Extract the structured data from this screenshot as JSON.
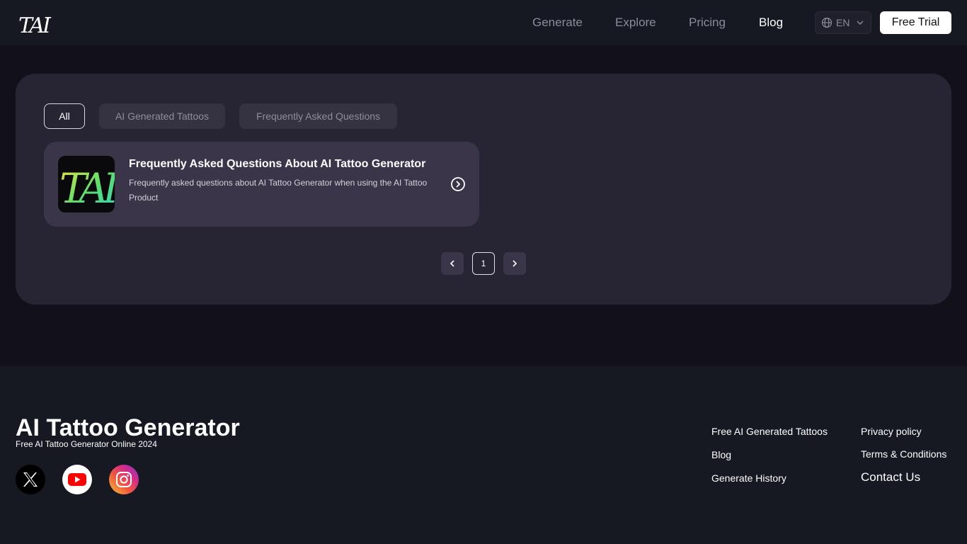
{
  "header": {
    "logo_text": "TAI",
    "nav": [
      {
        "label": "Generate",
        "active": false
      },
      {
        "label": "Explore",
        "active": false
      },
      {
        "label": "Pricing",
        "active": false
      },
      {
        "label": "Blog",
        "active": true
      }
    ],
    "language": {
      "label": "EN",
      "icon": "globe-icon"
    },
    "cta_label": "Free Trial"
  },
  "blog": {
    "filters": [
      {
        "label": "All",
        "active": true
      },
      {
        "label": "AI Generated Tattoos",
        "active": false
      },
      {
        "label": "Frequently Asked Questions",
        "active": false
      }
    ],
    "posts": [
      {
        "title": "Frequently Asked Questions About AI Tattoo Generator",
        "description": "Frequently asked questions about AI Tattoo Generator when using the AI Tattoo Product",
        "thumbnail_text": "TAI",
        "icon": "chevron-right-circle-icon"
      }
    ],
    "pagination": {
      "prev_icon": "chevron-left-icon",
      "current_page": "1",
      "next_icon": "chevron-right-icon"
    }
  },
  "footer": {
    "title": "AI Tattoo Generator",
    "subtitle": "Free AI Tattoo Generator Online 2024",
    "social": [
      "x-icon",
      "youtube-icon",
      "instagram-icon"
    ],
    "links_col1": [
      "Free AI Generated Tattoos",
      "Blog",
      "Generate History"
    ],
    "links_col2": [
      "Privacy policy",
      "Terms & Conditions",
      "Contact Us"
    ]
  },
  "colors": {
    "page_bg": "#12111a",
    "header_bg": "#161822",
    "panel_bg": "#272533",
    "card_bg": "#3a3548",
    "cta_bg": "#ffffff"
  }
}
